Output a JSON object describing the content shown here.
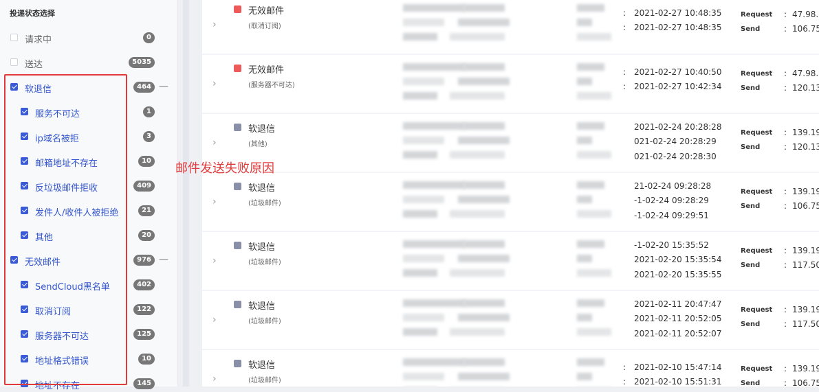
{
  "sidebar": {
    "title": "投递状态选择",
    "filters": [
      {
        "label": "请求中",
        "count": "0",
        "checked": false,
        "indent": false,
        "collapse": ""
      },
      {
        "label": "送达",
        "count": "5035",
        "checked": false,
        "indent": false,
        "collapse": ""
      },
      {
        "label": "软退信",
        "count": "464",
        "checked": true,
        "indent": false,
        "collapse": "—"
      },
      {
        "label": "服务不可达",
        "count": "1",
        "checked": true,
        "indent": true,
        "collapse": ""
      },
      {
        "label": "ip域名被拒",
        "count": "3",
        "checked": true,
        "indent": true,
        "collapse": ""
      },
      {
        "label": "邮箱地址不存在",
        "count": "10",
        "checked": true,
        "indent": true,
        "collapse": ""
      },
      {
        "label": "反垃圾邮件拒收",
        "count": "409",
        "checked": true,
        "indent": true,
        "collapse": ""
      },
      {
        "label": "发件人/收件人被拒绝",
        "count": "21",
        "checked": true,
        "indent": true,
        "collapse": ""
      },
      {
        "label": "其他",
        "count": "20",
        "checked": true,
        "indent": true,
        "collapse": ""
      },
      {
        "label": "无效邮件",
        "count": "976",
        "checked": true,
        "indent": false,
        "collapse": "—"
      },
      {
        "label": "SendCloud黑名单",
        "count": "402",
        "checked": true,
        "indent": true,
        "collapse": ""
      },
      {
        "label": "取消订阅",
        "count": "122",
        "checked": true,
        "indent": true,
        "collapse": ""
      },
      {
        "label": "服务器不可达",
        "count": "125",
        "checked": true,
        "indent": true,
        "collapse": ""
      },
      {
        "label": "地址格式错误",
        "count": "10",
        "checked": true,
        "indent": true,
        "collapse": ""
      },
      {
        "label": "地址不存在",
        "count": "145",
        "checked": true,
        "indent": true,
        "collapse": ""
      }
    ]
  },
  "annotation": "邮件发送失败原因",
  "colors": {
    "invalid": "#ee5a5a",
    "soft": "#8a8fa8",
    "accent": "#3b5bd6",
    "annotation": "#e03a3a"
  },
  "rows": [
    {
      "status": "无效邮件",
      "reason": "(取消订阅)",
      "color": "invalid",
      "times": [
        "2021-02-27 10:48:35",
        "2021-02-27 10:48:35"
      ],
      "request": "47.98.",
      "send": "106.75"
    },
    {
      "status": "无效邮件",
      "reason": "(服务器不可达)",
      "color": "invalid",
      "times": [
        "2021-02-27 10:40:50",
        "2021-02-27 10:42:34"
      ],
      "request": "47.98.",
      "send": "120.13"
    },
    {
      "status": "软退信",
      "reason": "(其他)",
      "color": "soft",
      "times": [
        "2021-02-24 20:28:28",
        "021-02-24 20:28:29",
        "021-02-24 20:28:30"
      ],
      "request": "139.19",
      "send": "120.13"
    },
    {
      "status": "软退信",
      "reason": "(垃圾邮件)",
      "color": "soft",
      "times": [
        "21-02-24 09:28:28",
        "-1-02-24 09:28:29",
        "-1-02-24 09:29:51"
      ],
      "request": "139.19",
      "send": "106.75"
    },
    {
      "status": "软退信",
      "reason": "(垃圾邮件)",
      "color": "soft",
      "times": [
        "-1-02-20 15:35:52",
        "2021-02-20 15:35:54",
        "2021-02-20 15:35:55"
      ],
      "request": "139.19",
      "send": "117.50"
    },
    {
      "status": "软退信",
      "reason": "(垃圾邮件)",
      "color": "soft",
      "times": [
        "2021-02-11 20:47:47",
        "2021-02-11 20:52:05",
        "2021-02-11 20:52:07"
      ],
      "request": "139.19",
      "send": "117.50"
    },
    {
      "status": "软退信",
      "reason": "(垃圾邮件)",
      "color": "soft",
      "times": [
        "2021-02-10 15:47:14",
        "2021-02-10 15:51:31"
      ],
      "request": "139.19",
      "send": "106.75"
    }
  ],
  "labels": {
    "request": "Request",
    "send": "Send",
    "colon": ":",
    "chevron": "›"
  }
}
